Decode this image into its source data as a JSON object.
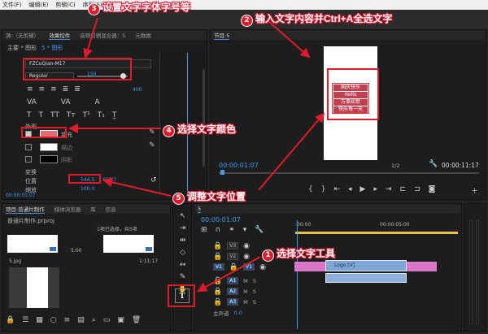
{
  "menu": [
    "文件(F)",
    "编辑(E)",
    "剪辑(C)",
    "序列(S)"
  ],
  "effect_controls": {
    "tabs": [
      "源:（无剪辑）",
      "效果控件",
      "音频剪辑混合器：5",
      "元数据"
    ],
    "clip_path": "主要 * 图形",
    "clip_target": "5 * 图形",
    "font": "FZCuQian-M17",
    "style": "Regular",
    "size": "150",
    "kerning": "400",
    "appearance_label": "外观",
    "fill_label": "填充",
    "stroke_label": "描边",
    "shadow_label": "阴影",
    "transform_label": "变换",
    "position_label": "位置",
    "position_value": "544.5",
    "position_value_y": "658.7",
    "scale_label": "缩放",
    "scale_value": "100.0",
    "timecode": "00:00:01:07",
    "fill_color": "#e26a73"
  },
  "program": {
    "tab": "节目:5",
    "text_lines": [
      "国庆快乐",
      "Hello",
      "万事如意",
      "快乐每一天"
    ],
    "timecode_left": "00:00:01:07",
    "fraction": "1/2",
    "timecode_right": "00:00:11:17"
  },
  "project": {
    "tabs": [
      "项目:普通片制作",
      "媒体浏览器",
      "库",
      "信息"
    ],
    "project_file": "普通片制作.prproj",
    "selection_info": "1项已选择，共5项",
    "item1_dur": "5:00",
    "item2_name": "5.jpg",
    "item2_dur": "1:11:17"
  },
  "timeline": {
    "tab": "5",
    "timecode": "00:00:01:07",
    "ruler_start": ":00:00",
    "ruler_mid": "00:00:05:00",
    "tracks_video": [
      "V3",
      "V2",
      "V1"
    ],
    "tracks_audio": [
      "A1",
      "A2",
      "A3"
    ],
    "master": "主声道",
    "master_val": "0.0",
    "clip_v2": "Logo [V]",
    "clip_a1": ""
  },
  "annotations": [
    {
      "num": "1",
      "text": "选择文字工具"
    },
    {
      "num": "2",
      "text": "输入文字内容并Ctrl+A全选文字"
    },
    {
      "num": "3",
      "text": "设置文字字体字号等"
    },
    {
      "num": "4",
      "text": "选择文字颜色"
    },
    {
      "num": "5",
      "text": "调整文字位置"
    }
  ],
  "colors": {
    "accent": "#3d9cf2",
    "annotation_red": "#e01b2d",
    "clip_pink": "#d977c8",
    "clip_blue": "#7fa4d6"
  }
}
